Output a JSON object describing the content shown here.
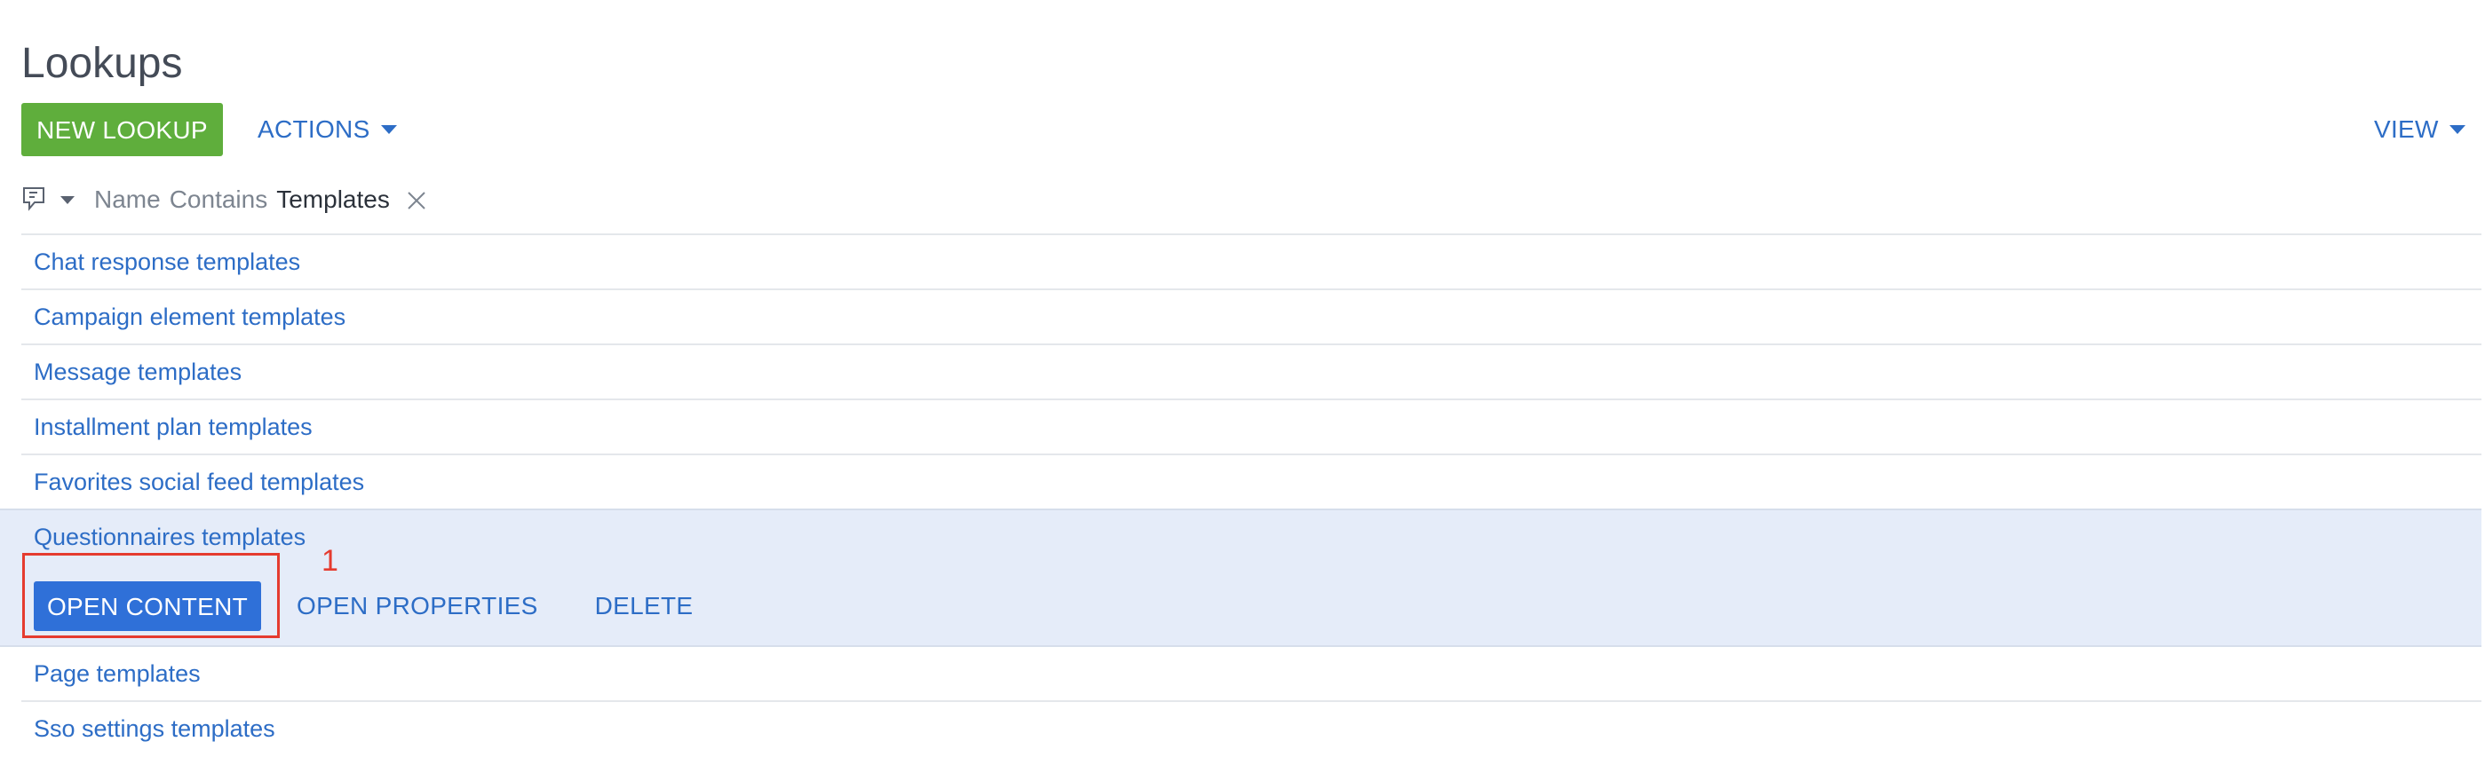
{
  "page": {
    "title": "Lookups"
  },
  "toolbar": {
    "new_label": "NEW LOOKUP",
    "actions_label": "ACTIONS",
    "view_label": "VIEW"
  },
  "filter": {
    "field": "Name",
    "operator": "Contains",
    "value": "Templates",
    "icon": "filter-icon",
    "clear_icon": "close-icon"
  },
  "list": {
    "items_before": [
      "Chat response templates",
      "Campaign element templates",
      "Message templates",
      "Installment plan templates",
      "Favorites social feed templates"
    ],
    "selected": {
      "label": "Questionnaires templates",
      "actions": {
        "open_content": "OPEN CONTENT",
        "open_properties": "OPEN PROPERTIES",
        "delete": "DELETE"
      }
    },
    "items_after": [
      "Page templates",
      "Sso settings templates"
    ]
  },
  "annotation": {
    "number": "1"
  },
  "colors": {
    "accent_green": "#5fae3c",
    "accent_blue": "#2f70d8",
    "link_blue": "#2d6dc6",
    "selected_bg": "#e5ecf9",
    "highlight_red": "#e53b2f"
  }
}
